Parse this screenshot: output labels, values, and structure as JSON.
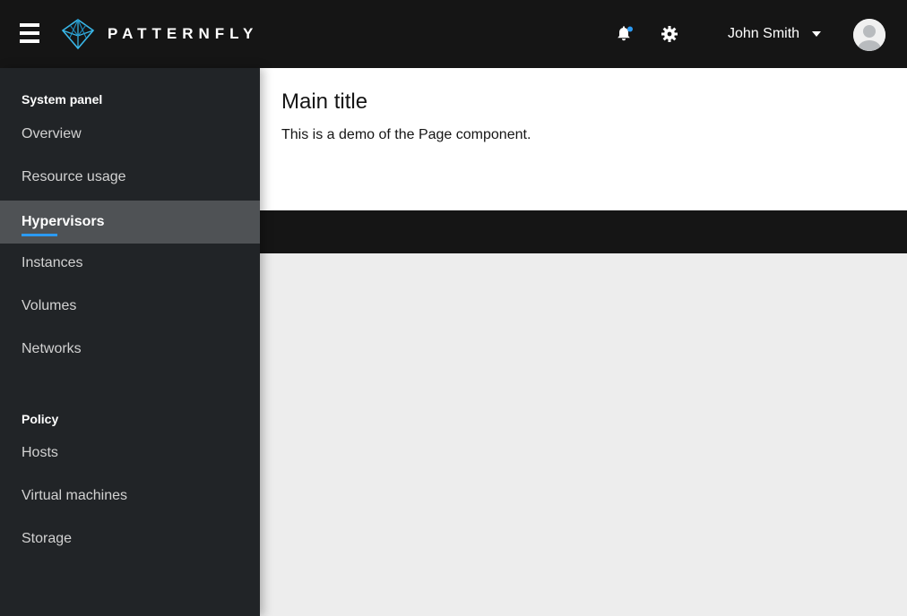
{
  "header": {
    "brand": "PATTERNFLY",
    "user_name": "John Smith",
    "icons": {
      "menu": "hamburger-menu-icon",
      "notifications": "bell-icon",
      "settings": "gear-icon",
      "user_dropdown": "caret-down-icon",
      "avatar": "avatar-icon"
    },
    "notification_badge_color": "#2b9af3"
  },
  "sidebar": {
    "sections": [
      {
        "title": "System panel",
        "items": [
          {
            "label": "Overview",
            "active": false
          },
          {
            "label": "Resource usage",
            "active": false
          },
          {
            "label": "Hypervisors",
            "active": true
          },
          {
            "label": "Instances",
            "active": false
          },
          {
            "label": "Volumes",
            "active": false
          },
          {
            "label": "Networks",
            "active": false
          }
        ]
      },
      {
        "title": "Policy",
        "items": [
          {
            "label": "Hosts",
            "active": false
          },
          {
            "label": "Virtual machines",
            "active": false
          },
          {
            "label": "Storage",
            "active": false
          }
        ]
      }
    ],
    "accent_color": "#2b9af3"
  },
  "main": {
    "title": "Main title",
    "description": "This is a demo of the Page component."
  }
}
